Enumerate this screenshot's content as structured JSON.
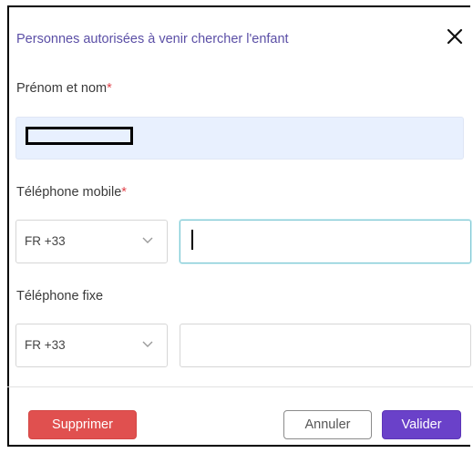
{
  "dialog": {
    "title": "Personnes autorisées à venir chercher l'enfant",
    "close_icon": "close-icon"
  },
  "fields": {
    "name_label": "Prénom et nom",
    "name_required_mark": "*",
    "mobile_label": "Téléphone mobile",
    "mobile_required_mark": "*",
    "mobile_country": "FR +33",
    "mobile_value": "",
    "fixed_label": "Téléphone fixe",
    "fixed_country": "FR +33",
    "fixed_value": ""
  },
  "buttons": {
    "delete": "Supprimer",
    "cancel": "Annuler",
    "validate": "Valider"
  },
  "colors": {
    "title": "#5b4fa6",
    "required": "#e0434b",
    "delete_bg": "#e0504f",
    "validate_bg": "#6a41c9",
    "name_field_bg": "#e8f0fe",
    "focus_border": "#7fc8d4"
  }
}
